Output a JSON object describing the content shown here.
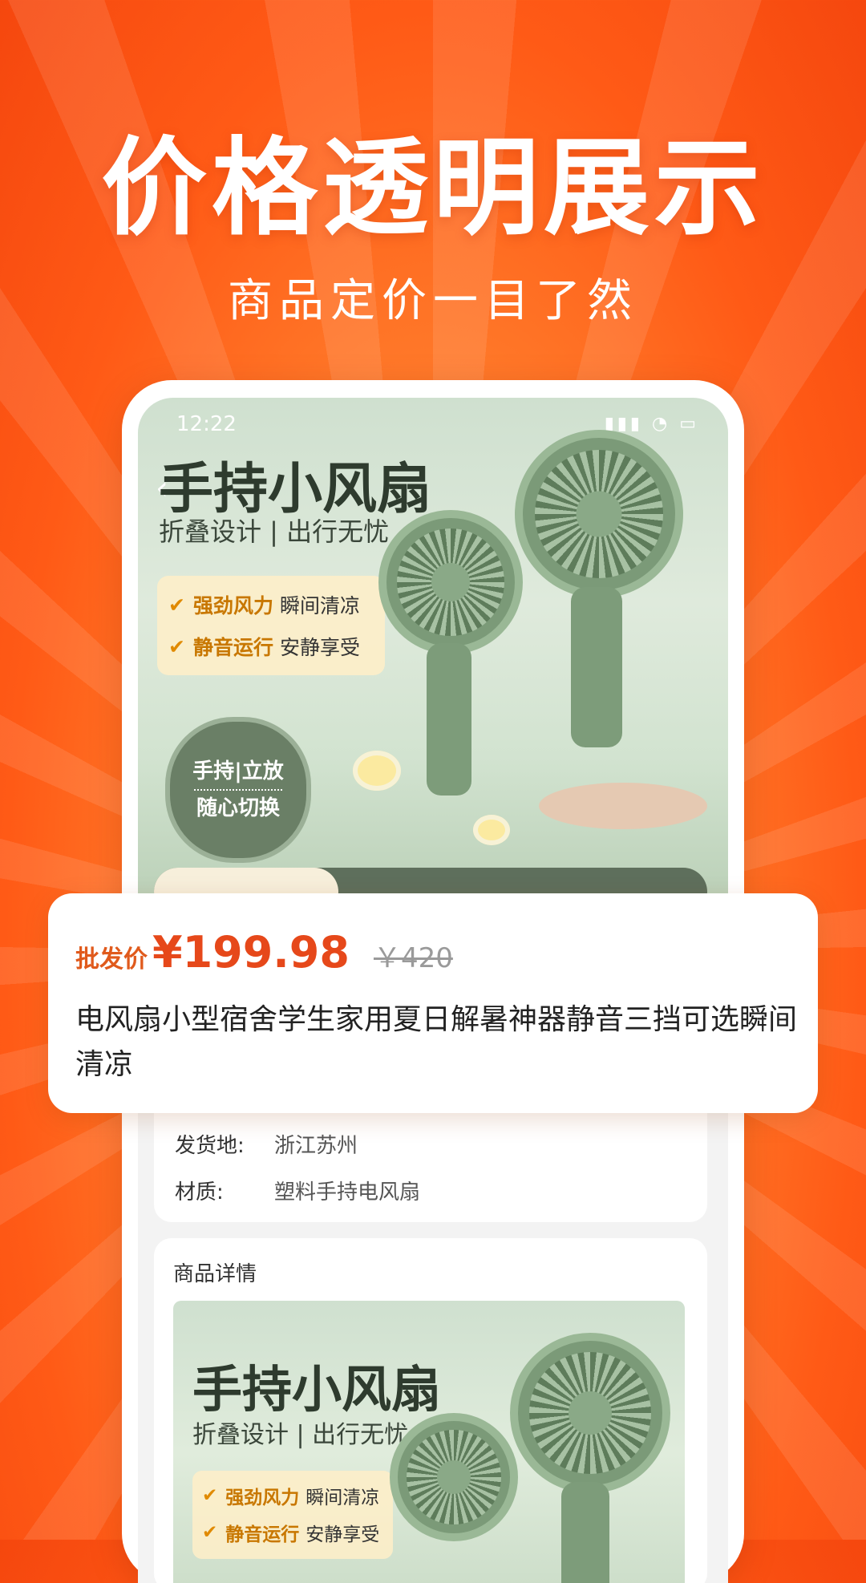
{
  "promo": {
    "headline": "价格透明展示",
    "subheadline": "商品定价一目了然"
  },
  "status_bar": {
    "time": "12:22",
    "icons": "▮▮▮ ◔ ▭"
  },
  "hero": {
    "title": "手持小风扇",
    "subtitle": "折叠设计 | 出行无忧",
    "features": [
      {
        "strong": "强劲风力",
        "text": "瞬间清凉"
      },
      {
        "strong": "静音运行",
        "text": "安静享受"
      }
    ],
    "badge_top": "手持|立放",
    "badge_bottom": "随心切换"
  },
  "price_card": {
    "price_label": "批发价",
    "price": "¥199.98",
    "original_price": "￥420",
    "title": "电风扇小型宿舍学生家用夏日解暑神器静音三挡可选瞬间清凉"
  },
  "info": {
    "rows": [
      {
        "key": "发货地:",
        "value": "浙江苏州"
      },
      {
        "key": "材质:",
        "value": "塑料手持电风扇"
      }
    ]
  },
  "detail": {
    "title": "商品详情",
    "hero_title": "手持小风扇",
    "hero_subtitle": "折叠设计 | 出行无忧",
    "features": [
      {
        "strong": "强劲风力",
        "text": "瞬间清凉"
      },
      {
        "strong": "静音运行",
        "text": "安静享受"
      }
    ]
  },
  "colors": {
    "accent": "#e6481a",
    "background": "#ff6a20"
  },
  "icons": [
    "back-arrow-icon",
    "check-icon",
    "signal-icon",
    "wifi-icon",
    "battery-icon"
  ]
}
